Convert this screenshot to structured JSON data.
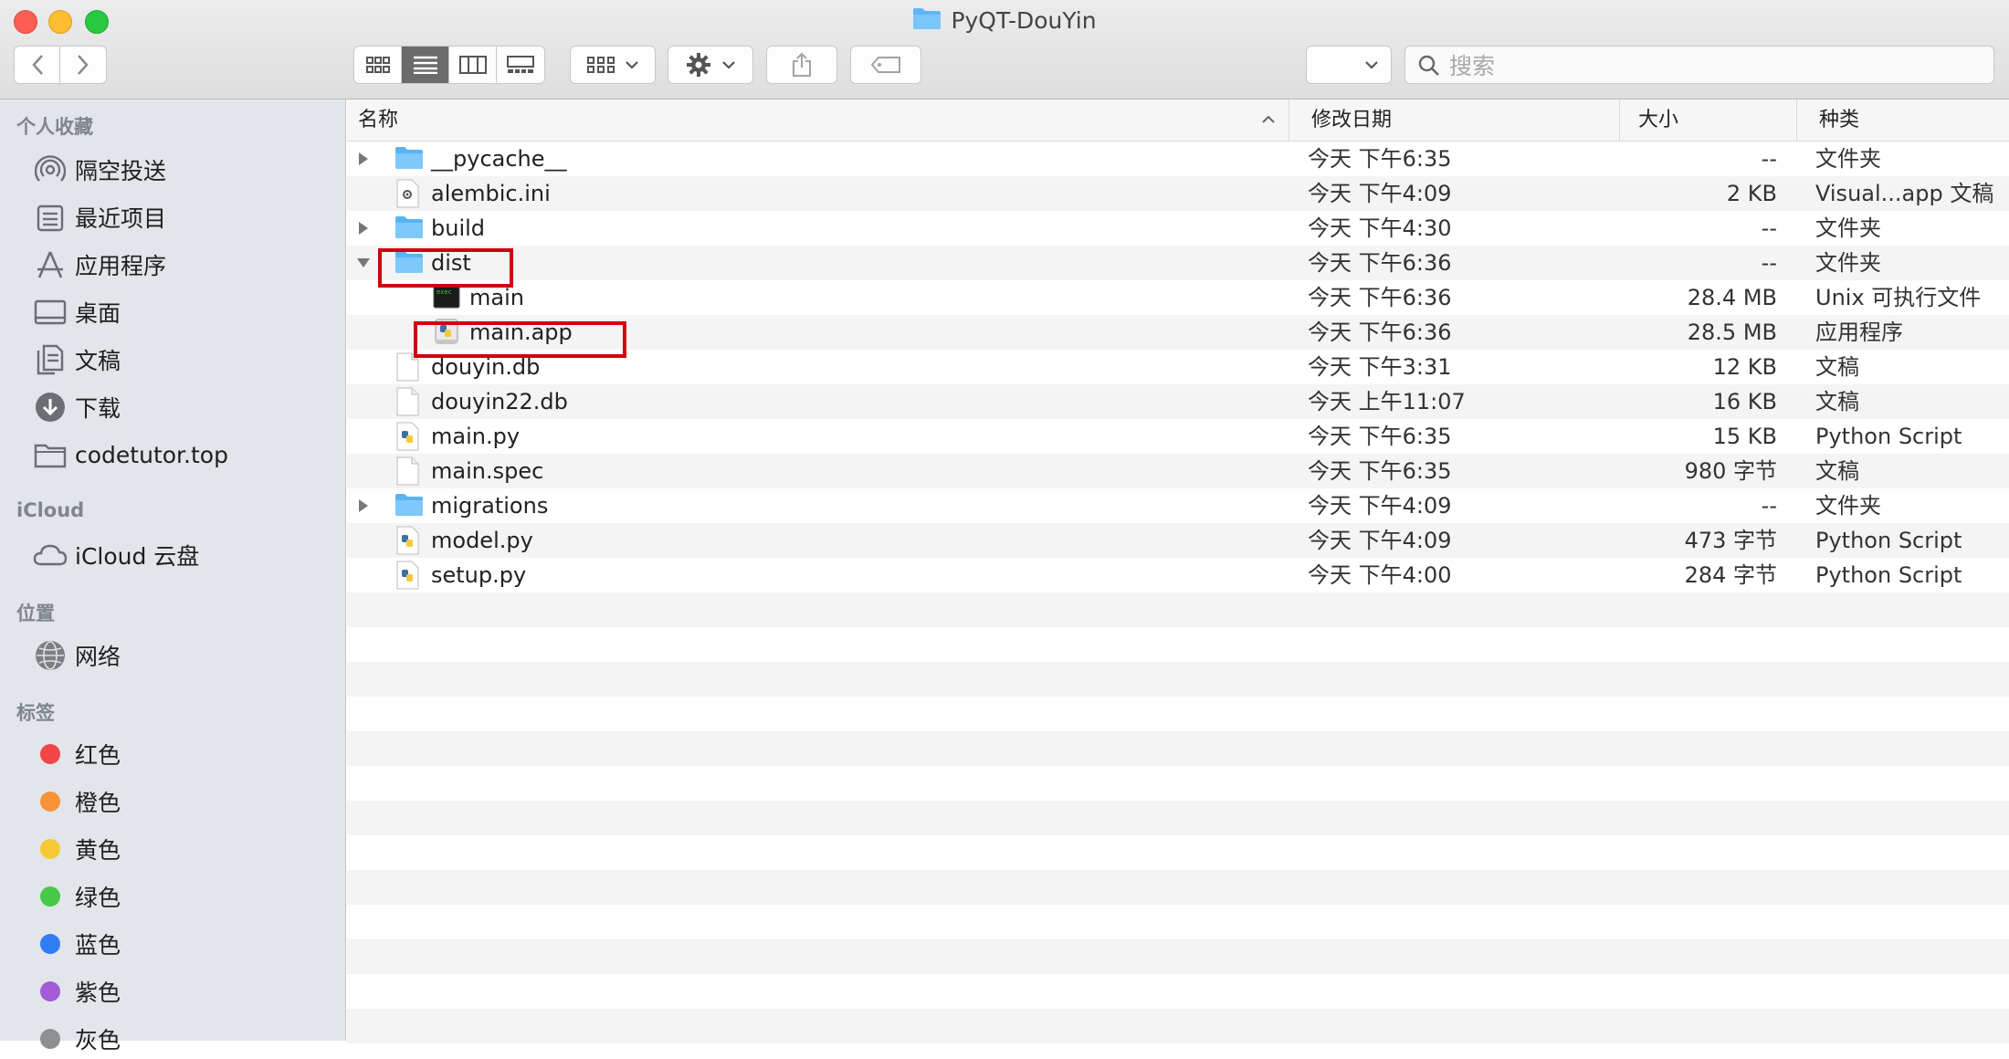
{
  "window": {
    "title": "PyQT-DouYin"
  },
  "search": {
    "placeholder": "搜索"
  },
  "sidebar": {
    "favorites_header": "个人收藏",
    "favorites": [
      {
        "label": "隔空投送",
        "icon": "airdrop-icon"
      },
      {
        "label": "最近项目",
        "icon": "recents-icon"
      },
      {
        "label": "应用程序",
        "icon": "applications-icon"
      },
      {
        "label": "桌面",
        "icon": "desktop-icon"
      },
      {
        "label": "文稿",
        "icon": "documents-icon"
      },
      {
        "label": "下载",
        "icon": "downloads-icon"
      },
      {
        "label": "codetutor.top",
        "icon": "folder-icon"
      }
    ],
    "icloud_header": "iCloud",
    "icloud": [
      {
        "label": "iCloud 云盘",
        "icon": "cloud-icon"
      }
    ],
    "locations_header": "位置",
    "locations": [
      {
        "label": "网络",
        "icon": "network-icon"
      }
    ],
    "tags_header": "标签",
    "tags": [
      {
        "label": "红色",
        "color": "#f24646"
      },
      {
        "label": "橙色",
        "color": "#f7923a"
      },
      {
        "label": "黄色",
        "color": "#f7c934"
      },
      {
        "label": "绿色",
        "color": "#46c946"
      },
      {
        "label": "蓝色",
        "color": "#2f7cf6"
      },
      {
        "label": "紫色",
        "color": "#a45bd6"
      },
      {
        "label": "灰色",
        "color": "#8e8e93"
      }
    ]
  },
  "columns": {
    "name": "名称",
    "date": "修改日期",
    "size": "大小",
    "kind": "种类"
  },
  "files": [
    {
      "name": "__pycache__",
      "date": "今天 下午6:35",
      "size": "--",
      "kind": "文件夹",
      "icon": "folder-icon",
      "disclosure": "collapsed",
      "indent": 0
    },
    {
      "name": "alembic.ini",
      "date": "今天 下午4:09",
      "size": "2 KB",
      "kind": "Visual...app 文稿",
      "icon": "config-file-icon",
      "disclosure": "none",
      "indent": 0
    },
    {
      "name": "build",
      "date": "今天 下午4:30",
      "size": "--",
      "kind": "文件夹",
      "icon": "folder-icon",
      "disclosure": "collapsed",
      "indent": 0
    },
    {
      "name": "dist",
      "date": "今天 下午6:36",
      "size": "--",
      "kind": "文件夹",
      "icon": "folder-icon",
      "disclosure": "expanded",
      "indent": 0
    },
    {
      "name": "main",
      "date": "今天 下午6:36",
      "size": "28.4 MB",
      "kind": "Unix 可执行文件",
      "icon": "terminal-exec-icon",
      "disclosure": "none",
      "indent": 1
    },
    {
      "name": "main.app",
      "date": "今天 下午6:36",
      "size": "28.5 MB",
      "kind": "应用程序",
      "icon": "app-icon",
      "disclosure": "none",
      "indent": 1
    },
    {
      "name": "douyin.db",
      "date": "今天 下午3:31",
      "size": "12 KB",
      "kind": "文稿",
      "icon": "document-icon",
      "disclosure": "none",
      "indent": 0
    },
    {
      "name": "douyin22.db",
      "date": "今天 上午11:07",
      "size": "16 KB",
      "kind": "文稿",
      "icon": "document-icon",
      "disclosure": "none",
      "indent": 0
    },
    {
      "name": "main.py",
      "date": "今天 下午6:35",
      "size": "15 KB",
      "kind": "Python Script",
      "icon": "python-file-icon",
      "disclosure": "none",
      "indent": 0
    },
    {
      "name": "main.spec",
      "date": "今天 下午6:35",
      "size": "980 字节",
      "kind": "文稿",
      "icon": "document-icon",
      "disclosure": "none",
      "indent": 0
    },
    {
      "name": "migrations",
      "date": "今天 下午4:09",
      "size": "--",
      "kind": "文件夹",
      "icon": "folder-icon",
      "disclosure": "collapsed",
      "indent": 0
    },
    {
      "name": "model.py",
      "date": "今天 下午4:09",
      "size": "473 字节",
      "kind": "Python Script",
      "icon": "python-file-icon",
      "disclosure": "none",
      "indent": 0
    },
    {
      "name": "setup.py",
      "date": "今天 下午4:00",
      "size": "284 字节",
      "kind": "Python Script",
      "icon": "python-file-icon",
      "disclosure": "none",
      "indent": 0
    }
  ]
}
